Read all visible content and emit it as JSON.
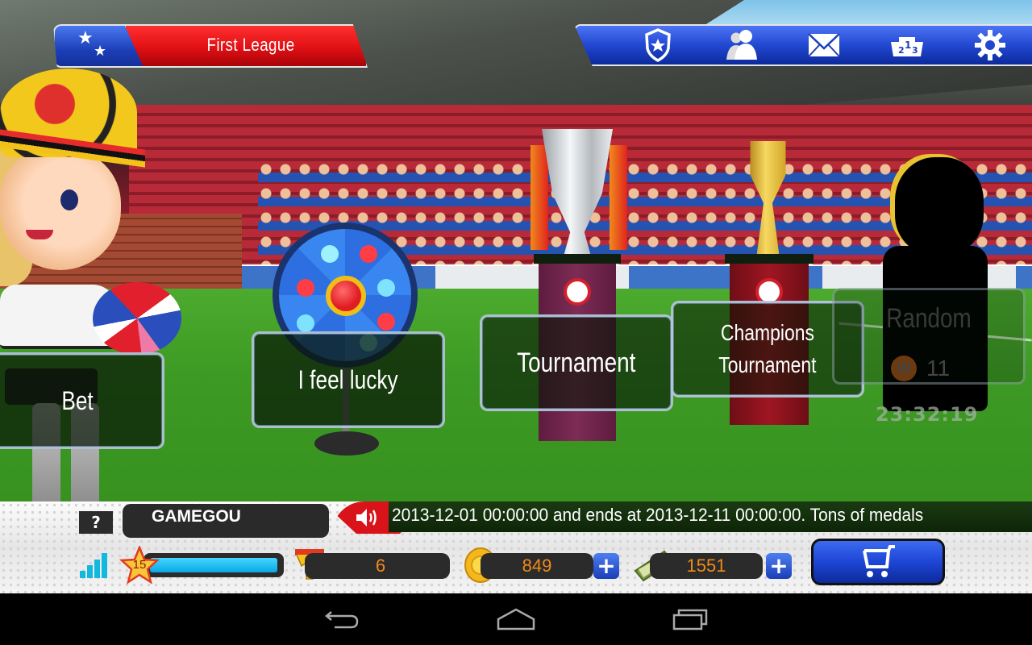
{
  "header": {
    "league_title": "First League",
    "league_icon": "two-stars-icon",
    "nav_icons": [
      {
        "name": "club-shield-icon",
        "label": "Club"
      },
      {
        "name": "friends-icon",
        "label": "Friends"
      },
      {
        "name": "mail-icon",
        "label": "Mail"
      },
      {
        "name": "ranking-podium-icon",
        "label": "Ranking"
      },
      {
        "name": "settings-gear-icon",
        "label": "Settings"
      }
    ]
  },
  "menu": {
    "bet": "Bet",
    "lucky": "I feel lucky",
    "tournament": "Tournament",
    "champions": "Champions\nTournament",
    "random": {
      "title": "Random",
      "badge": "W",
      "count": "11",
      "timer": "23:32:19"
    }
  },
  "hud": {
    "help_label": "?",
    "player_name": "GAMEGOU",
    "ticker": "2013-12-01 00:00:00 and ends at 2013-12-11 00:00:00. Tons of medals",
    "level": "15",
    "xp_progress_percent": 100,
    "trophies": "6",
    "coins": "849",
    "cash": "1551",
    "plus_label": "+",
    "colors": {
      "hud_accent_blue": "#1e46d6",
      "league_red": "#e01014",
      "value_orange": "#f28a18",
      "xp_cyan": "#0aa7e6"
    }
  },
  "system_nav": {
    "back": "back-icon",
    "home": "home-icon",
    "recents": "recent-apps-icon"
  }
}
